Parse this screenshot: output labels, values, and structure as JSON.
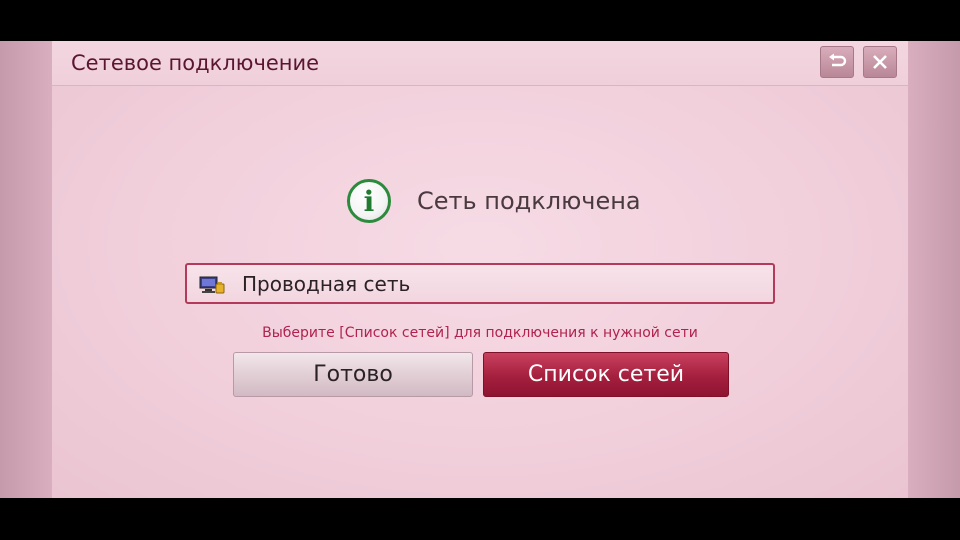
{
  "window": {
    "title": "Сетевое подключение",
    "back_icon": "back-arrow-icon",
    "close_icon": "close-icon"
  },
  "status": {
    "icon": "info-icon",
    "text": "Сеть подключена"
  },
  "network": {
    "icon": "wired-network-icon",
    "label": "Проводная сеть"
  },
  "hint": "Выберите [Список сетей] для подключения к нужной сети",
  "buttons": {
    "done_label": "Готово",
    "network_list_label": "Список сетей"
  },
  "colors": {
    "accent": "#a51f3e",
    "hint": "#b0224f",
    "info_ring": "#2b8a3b"
  }
}
